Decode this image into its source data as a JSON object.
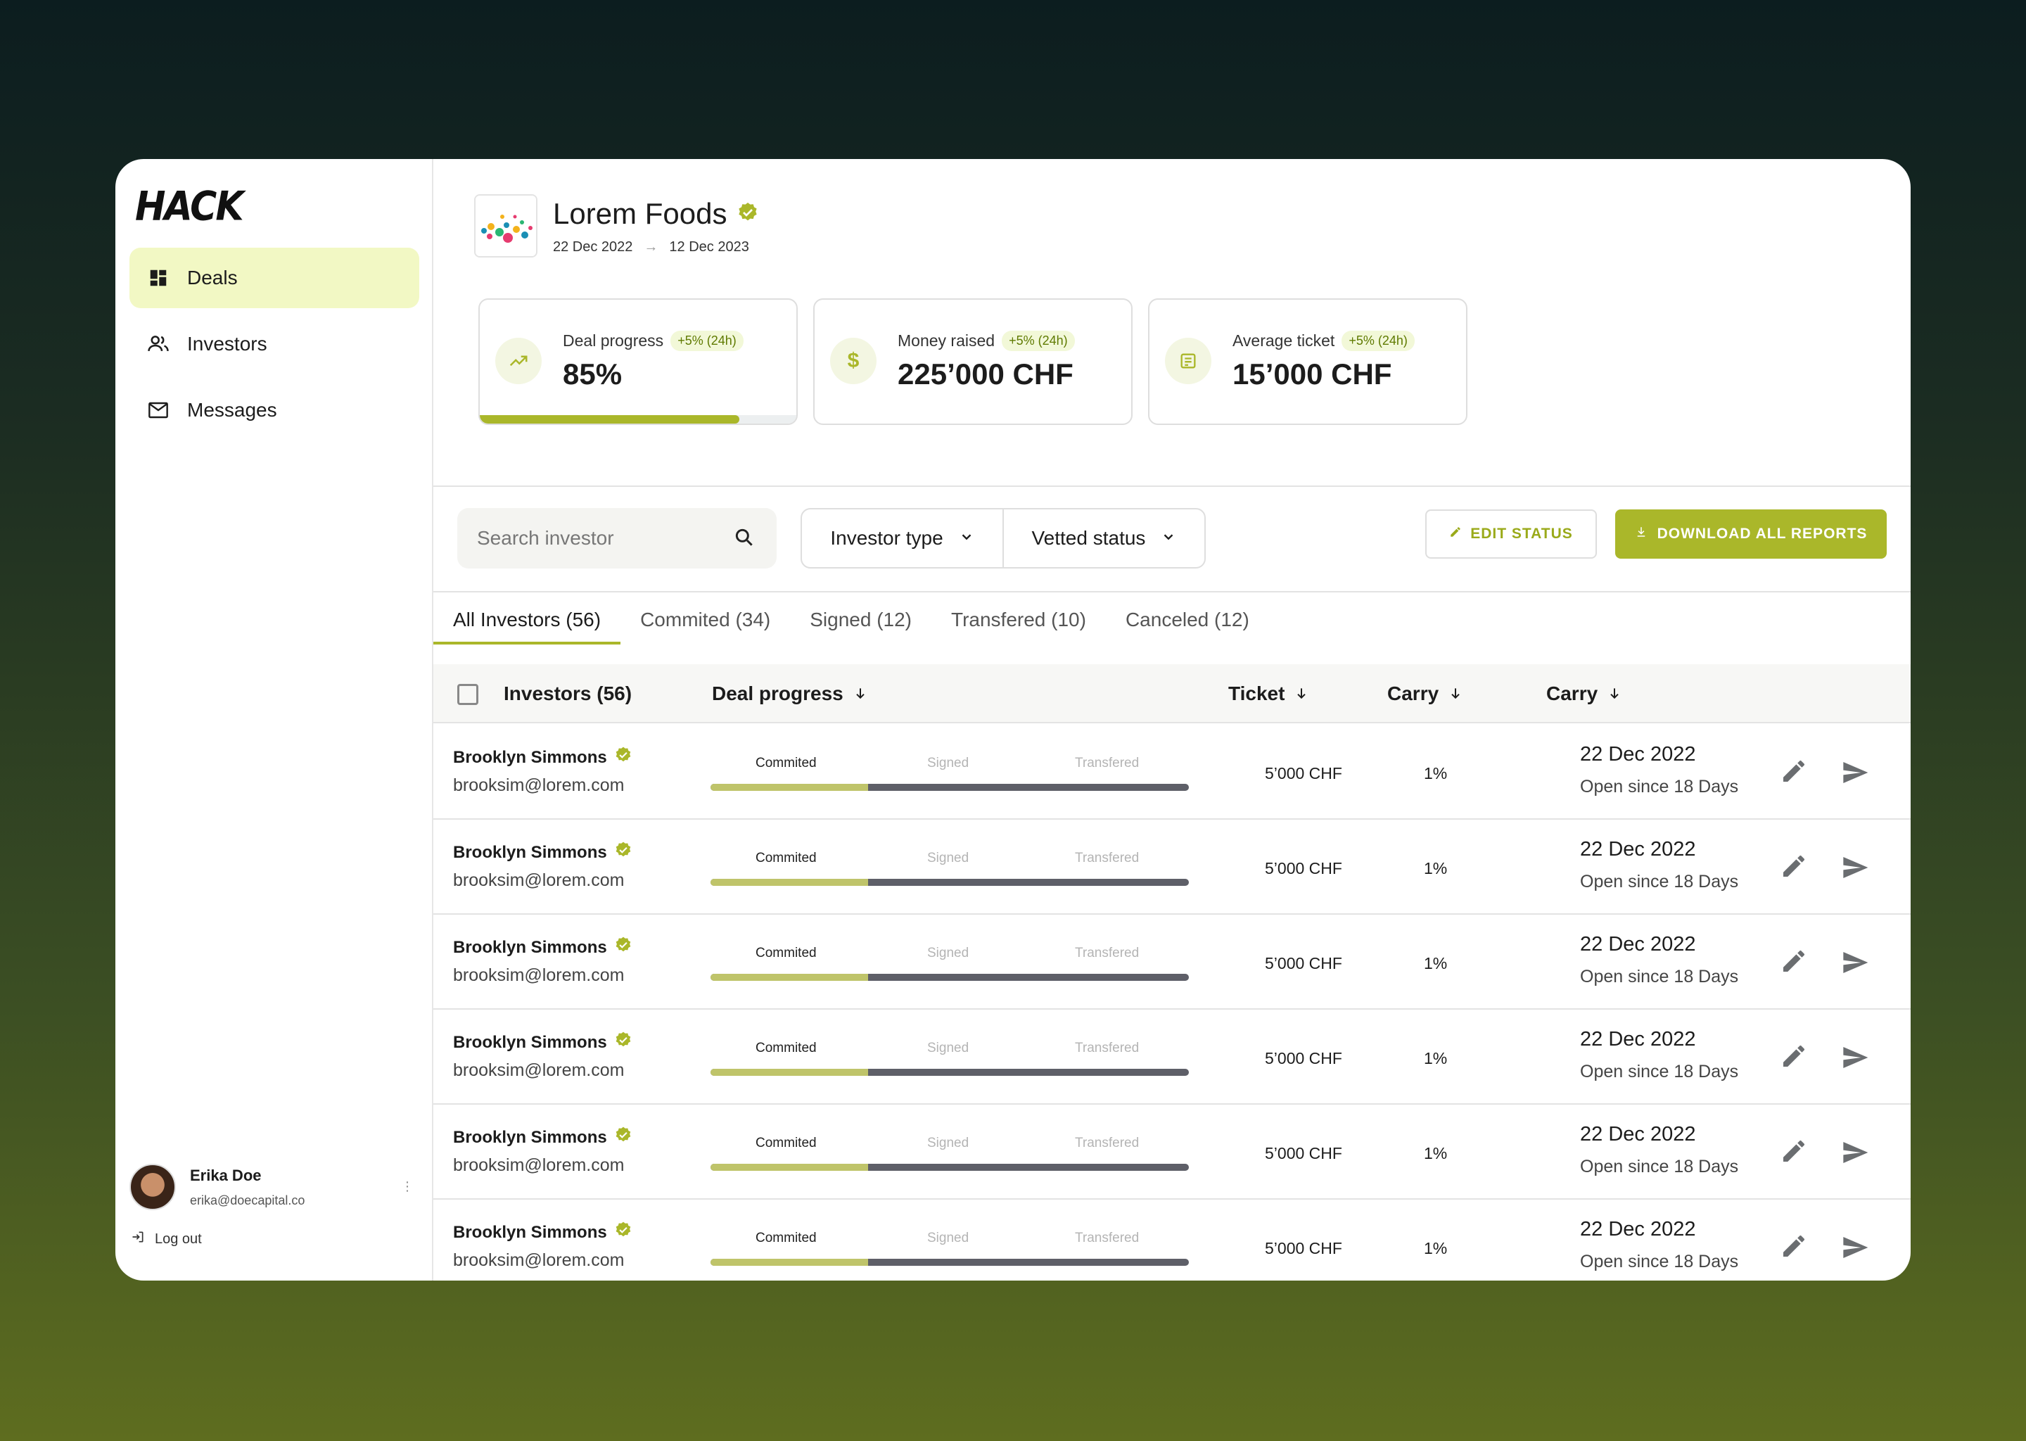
{
  "sidebar": {
    "logo": "HACK",
    "items": [
      {
        "label": "Deals",
        "icon": "dashboard-icon",
        "active": true
      },
      {
        "label": "Investors",
        "icon": "people-icon",
        "active": false
      },
      {
        "label": "Messages",
        "icon": "mail-icon",
        "active": false
      }
    ],
    "user": {
      "name": "Erika Doe",
      "email": "erika@doecapital.co"
    },
    "logout_label": "Log out"
  },
  "deal": {
    "title": "Lorem Foods",
    "start_date": "22 Dec 2022",
    "end_date": "12 Dec 2023"
  },
  "stats": [
    {
      "label": "Deal progress",
      "delta": "+5% (24h)",
      "value": "85%",
      "progress": 0.82,
      "icon": "trending-up-icon"
    },
    {
      "label": "Money raised",
      "delta": "+5% (24h)",
      "value": "225’000 CHF",
      "icon": "dollar-icon"
    },
    {
      "label": "Average ticket",
      "delta": "+5% (24h)",
      "value": "15’000 CHF",
      "icon": "note-icon"
    }
  ],
  "toolbar": {
    "search_placeholder": "Search investor",
    "filter_type": "Investor type",
    "filter_vetted": "Vetted status",
    "edit_status": "EDIT STATUS",
    "download_reports": "DOWNLOAD ALL REPORTS"
  },
  "tabs": [
    {
      "label": "All Investors (56)",
      "active": true
    },
    {
      "label": "Commited (34)",
      "active": false
    },
    {
      "label": "Signed (12)",
      "active": false
    },
    {
      "label": "Transfered (10)",
      "active": false
    },
    {
      "label": "Canceled (12)",
      "active": false
    }
  ],
  "table": {
    "headers": {
      "investors": "Investors (56)",
      "deal_progress": "Deal progress",
      "ticket": "Ticket",
      "carry1": "Carry",
      "carry2": "Carry"
    },
    "stages": [
      "Commited",
      "Signed",
      "Transfered"
    ],
    "rows": [
      {
        "name": "Brooklyn Simmons",
        "email": "brooksim@lorem.com",
        "progress": 0.33,
        "ticket": "5’000 CHF",
        "carry": "1%",
        "date": "22 Dec 2022",
        "since": "Open since 18 Days"
      },
      {
        "name": "Brooklyn Simmons",
        "email": "brooksim@lorem.com",
        "progress": 0.33,
        "ticket": "5’000 CHF",
        "carry": "1%",
        "date": "22 Dec 2022",
        "since": "Open since 18 Days"
      },
      {
        "name": "Brooklyn Simmons",
        "email": "brooksim@lorem.com",
        "progress": 0.33,
        "ticket": "5’000 CHF",
        "carry": "1%",
        "date": "22 Dec 2022",
        "since": "Open since 18 Days"
      },
      {
        "name": "Brooklyn Simmons",
        "email": "brooksim@lorem.com",
        "progress": 0.33,
        "ticket": "5’000 CHF",
        "carry": "1%",
        "date": "22 Dec 2022",
        "since": "Open since 18 Days"
      },
      {
        "name": "Brooklyn Simmons",
        "email": "brooksim@lorem.com",
        "progress": 0.33,
        "ticket": "5’000 CHF",
        "carry": "1%",
        "date": "22 Dec 2022",
        "since": "Open since 18 Days"
      },
      {
        "name": "Brooklyn Simmons",
        "email": "brooksim@lorem.com",
        "progress": 0.33,
        "ticket": "5’000 CHF",
        "carry": "1%",
        "date": "22 Dec 2022",
        "since": "Open since 18 Days"
      }
    ]
  },
  "colors": {
    "accent": "#aab72a",
    "accent_light": "#f2f8c4",
    "bar_track": "#5e5f68",
    "bar_fill": "#bfc46a"
  }
}
